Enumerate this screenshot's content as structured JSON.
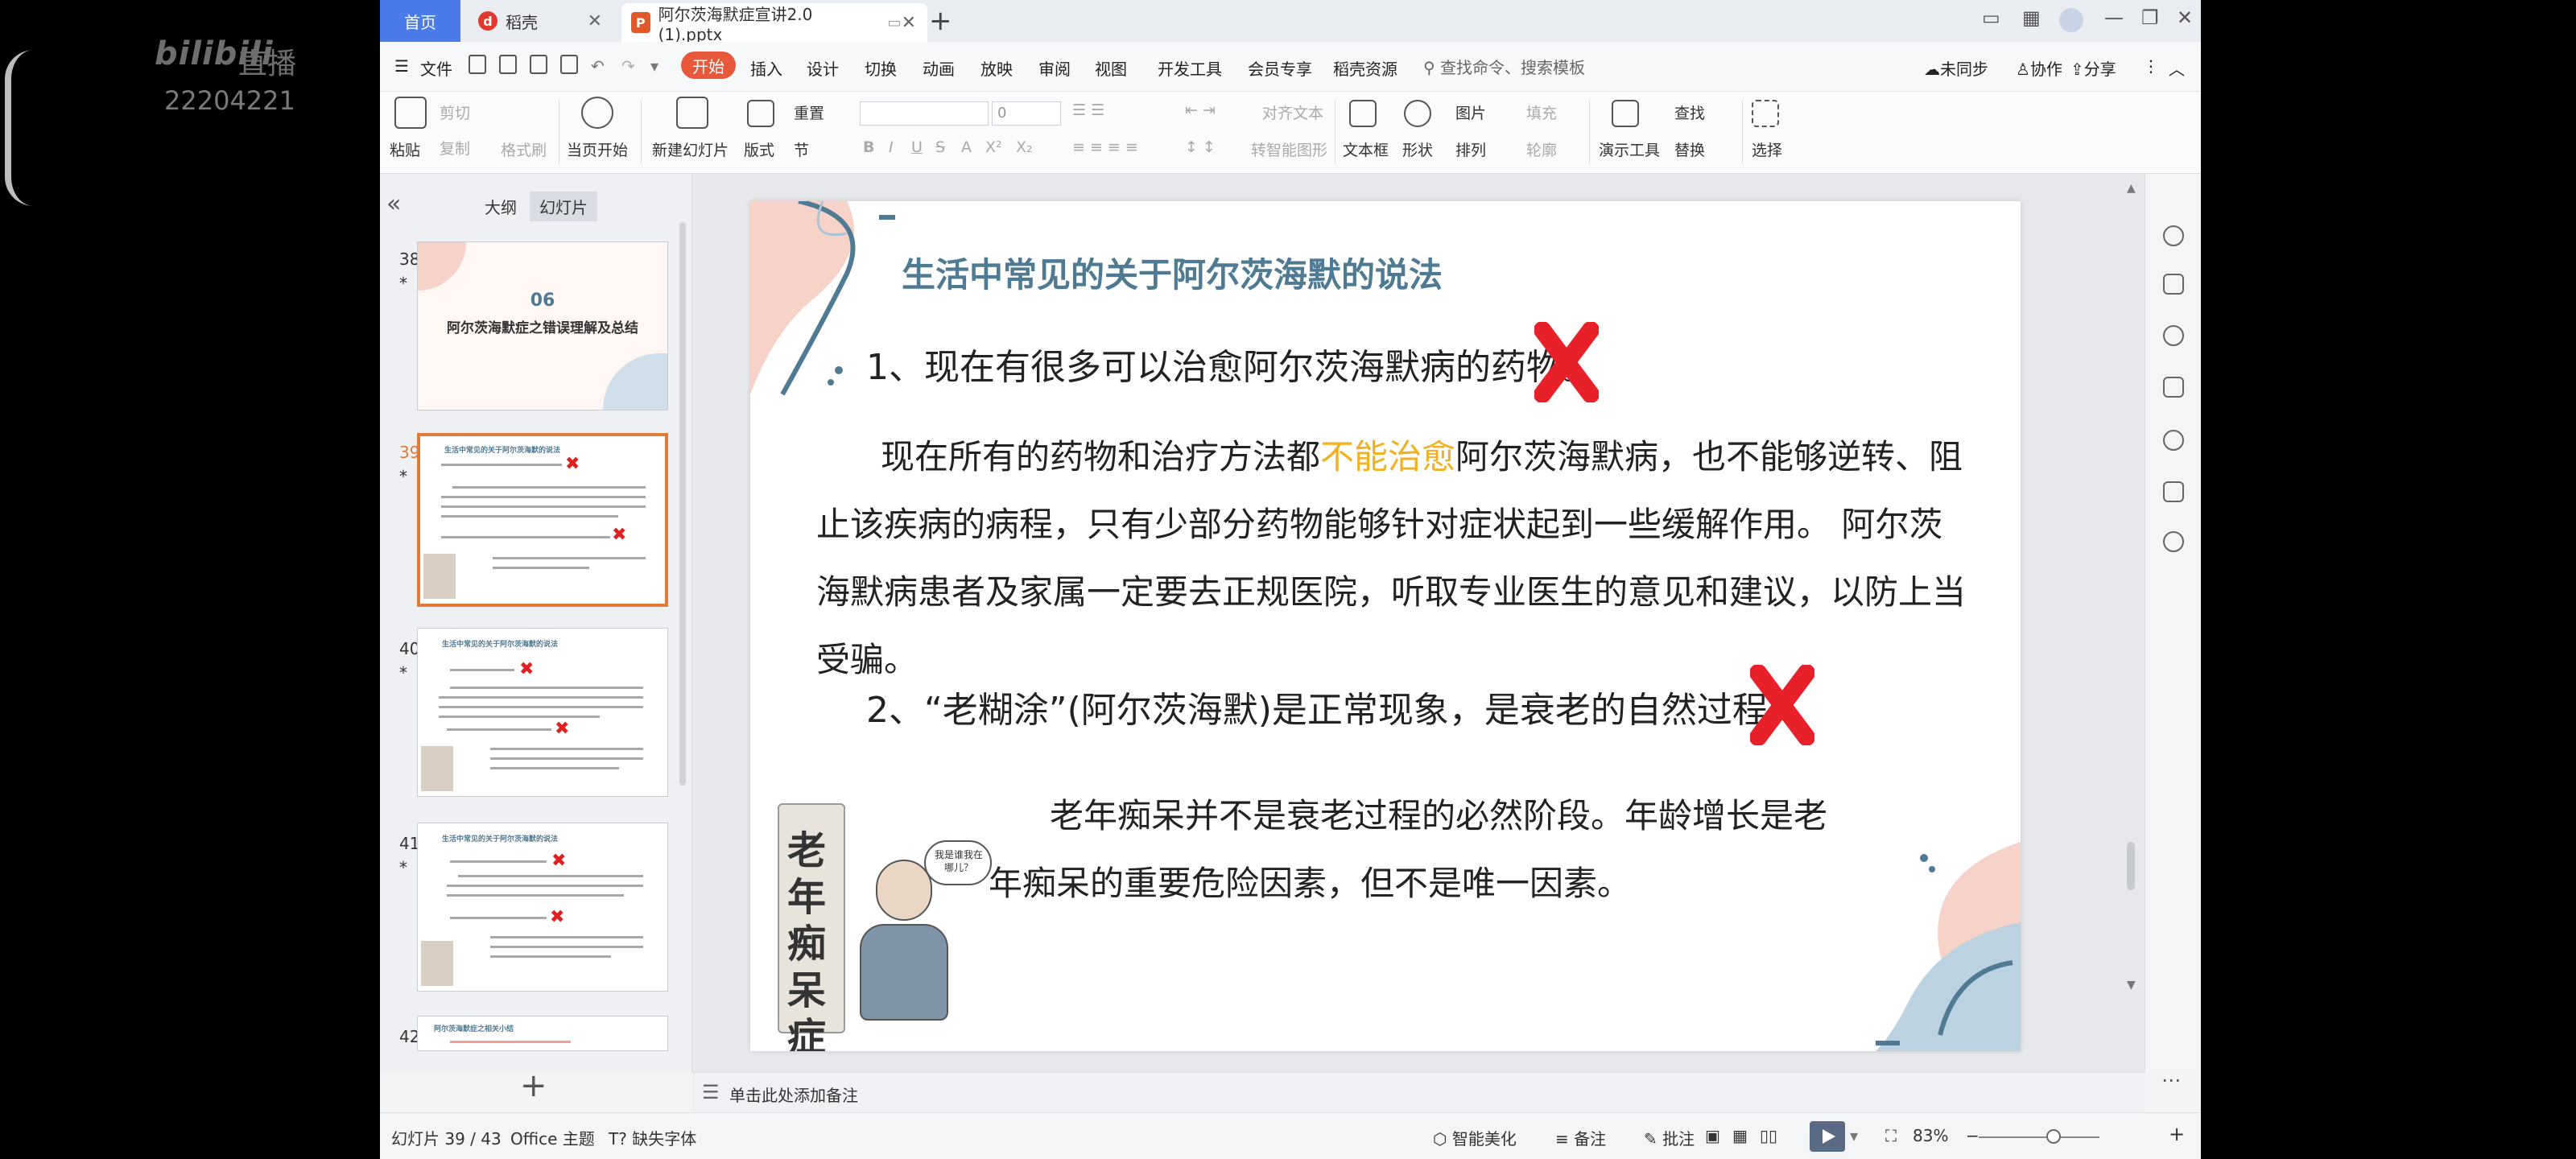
{
  "overlay": {
    "logo": "bilibili",
    "live": "直播",
    "room_id": "22204221"
  },
  "tabs": {
    "home": "首页",
    "daoke": "稻壳",
    "doc": "阿尔茨海默症宣讲2.0 (1).pptx",
    "add": "+"
  },
  "menu": {
    "file": "文件",
    "start": "开始",
    "items": [
      "插入",
      "设计",
      "切换",
      "动画",
      "放映",
      "审阅",
      "视图",
      "开发工具",
      "会员专享",
      "稻壳资源"
    ],
    "search": "查找命令、搜索模板",
    "unsynced": "未同步",
    "collab": "协作",
    "share": "分享"
  },
  "ribbon": {
    "paste": "粘贴",
    "cut": "剪切",
    "copy": "复制",
    "format_painter": "格式刷",
    "from_current": "当页开始",
    "new_slide": "新建幻灯片",
    "layout": "版式",
    "section": "节",
    "reset": "重置",
    "font_size": "0",
    "align_text": "对齐文本",
    "to_smartart": "转智能图形",
    "textbox": "文本框",
    "shape": "形状",
    "picture": "图片",
    "fill": "填充",
    "arrange": "排列",
    "outline": "轮廓",
    "present_tools": "演示工具",
    "find": "查找",
    "replace": "替换",
    "select": "选择"
  },
  "left_panel": {
    "tab_outline": "大纲",
    "tab_slides": "幻灯片",
    "slides": [
      {
        "num": "38",
        "title_num": "06",
        "title": "阿尔茨海默症之错误理解及总结"
      },
      {
        "num": "39",
        "title": "生活中常见的关于阿尔茨海默的说法"
      },
      {
        "num": "40",
        "title": "生活中常见的关于阿尔茨海默的说法"
      },
      {
        "num": "41",
        "title": "生活中常见的关于阿尔茨海默的说法"
      },
      {
        "num": "42",
        "title": "阿尔茨海默症之相关小结"
      }
    ],
    "star": "*",
    "add": "+"
  },
  "slide": {
    "title": "生活中常见的关于阿尔茨海默的说法",
    "point1": "1、现在有很多可以治愈阿尔茨海默病的药物。",
    "body1_pre": "现在所有的药物和治疗方法都",
    "body1_highlight": "不能治愈",
    "body1_post": "阿尔茨海默病，也不能够逆转、阻止该疾病的病程，只有少部分药物能够针对症状起到一些缓解作用。 阿尔茨海默病患者及家属一定要去正规医院，听取专业医生的意见和建议，以防上当受骗。",
    "point2": "2、“老糊涂”(阿尔茨海默)是正常现象，是衰老的自然过程",
    "body2": "老年痴呆并不是衰老过程的必然阶段。年龄增长是老年痴呆的重要危险因素，但不是唯一因素。",
    "scroll_text": "老年痴呆症",
    "bubble": "我是谁我在哪儿？",
    "highlight_color": "#f2b020",
    "x_color": "#e8202a"
  },
  "notes": {
    "placeholder": "单击此处添加备注"
  },
  "status": {
    "slide_info": "幻灯片 39 / 43",
    "theme": "Office 主题",
    "missing_font": "缺失字体",
    "beautify": "智能美化",
    "notes": "备注",
    "comments": "批注",
    "zoom": "83%"
  }
}
